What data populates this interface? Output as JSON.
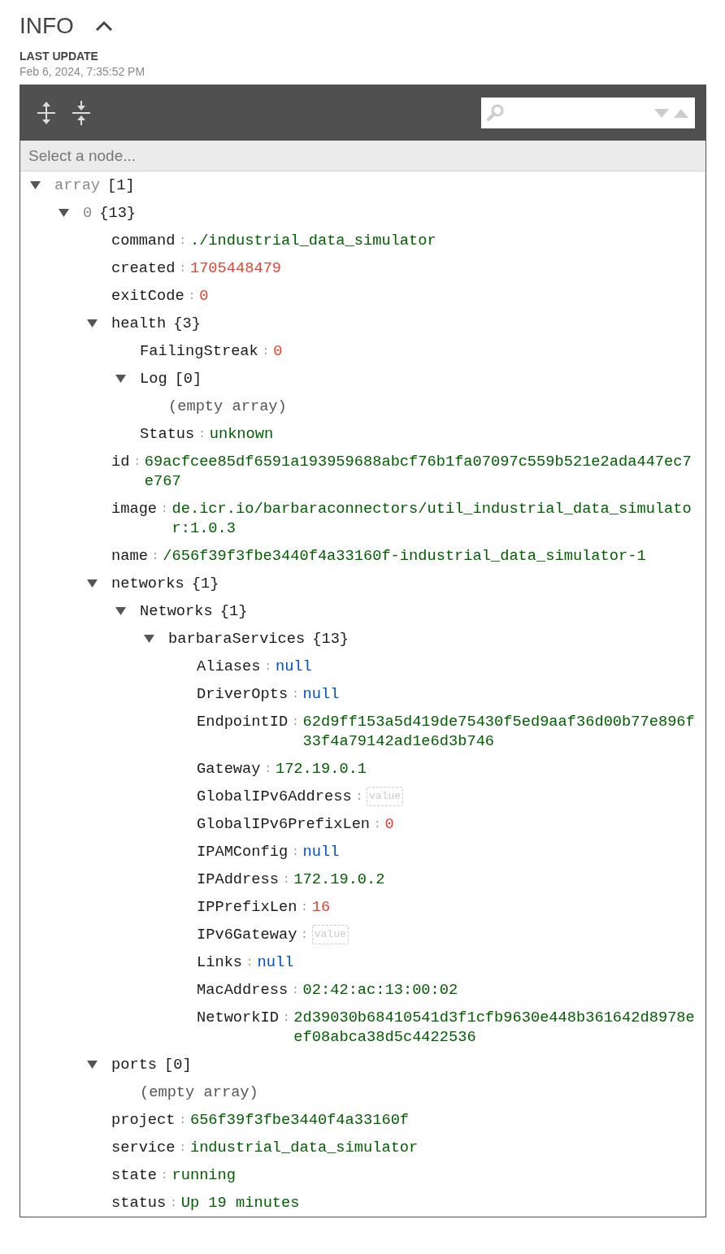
{
  "header": {
    "title": "INFO",
    "expanded": true,
    "update_label": "LAST UPDATE",
    "update_time": "Feb 6, 2024, 7:35:52 PM"
  },
  "editor": {
    "navigation_placeholder": "Select a node...",
    "tree": {
      "key": "array",
      "muted": true,
      "kind": "array",
      "count": "[1]",
      "expanded": true,
      "children": [
        {
          "key": "0",
          "muted": true,
          "kind": "object",
          "count": "{13}",
          "expanded": true,
          "children": [
            {
              "key": "command",
              "colon": ":",
              "kind": "string",
              "value": "./industrial_data_simulator"
            },
            {
              "key": "created",
              "colon": ":",
              "kind": "number",
              "value": "1705448479"
            },
            {
              "key": "exitCode",
              "colon": ":",
              "kind": "number",
              "value": "0"
            },
            {
              "key": "health",
              "kind": "object",
              "count": "{3}",
              "expanded": true,
              "children": [
                {
                  "key": "FailingStreak",
                  "colon": ":",
                  "kind": "number",
                  "value": "0"
                },
                {
                  "key": "Log",
                  "kind": "array",
                  "count": "[0]",
                  "expanded": true,
                  "empty_text": "(empty array)"
                },
                {
                  "key": "Status",
                  "colon": ":",
                  "kind": "string",
                  "value": "unknown"
                }
              ]
            },
            {
              "key": "id",
              "colon": ":",
              "kind": "string",
              "value": "69acfcee85df6591a193959688abcf76b1fa07097c559b521e2ada447ec7e767"
            },
            {
              "key": "image",
              "colon": ":",
              "kind": "string",
              "value": "de.icr.io/barbaraconnectors/util_industrial_data_simulator:1.0.3"
            },
            {
              "key": "name",
              "colon": ":",
              "kind": "string",
              "value": "/656f39f3fbe3440f4a33160f-industrial_data_simulator-1"
            },
            {
              "key": "networks",
              "kind": "object",
              "count": "{1}",
              "expanded": true,
              "children": [
                {
                  "key": "Networks",
                  "kind": "object",
                  "count": "{1}",
                  "expanded": true,
                  "children": [
                    {
                      "key": "barbaraServices",
                      "kind": "object",
                      "count": "{13}",
                      "expanded": true,
                      "children": [
                        {
                          "key": "Aliases",
                          "colon": ":",
                          "kind": "null",
                          "value": "null"
                        },
                        {
                          "key": "DriverOpts",
                          "colon": ":",
                          "kind": "null",
                          "value": "null"
                        },
                        {
                          "key": "EndpointID",
                          "colon": ":",
                          "kind": "string",
                          "value": "62d9ff153a5d419de75430f5ed9aaf36d00b77e896f33f4a79142ad1e6d3b746"
                        },
                        {
                          "key": "Gateway",
                          "colon": ":",
                          "kind": "string",
                          "value": "172.19.0.1"
                        },
                        {
                          "key": "GlobalIPv6Address",
                          "colon": ":",
                          "kind": "empty",
                          "placeholder": "value"
                        },
                        {
                          "key": "GlobalIPv6PrefixLen",
                          "colon": ":",
                          "kind": "number",
                          "value": "0"
                        },
                        {
                          "key": "IPAMConfig",
                          "colon": ":",
                          "kind": "null",
                          "value": "null"
                        },
                        {
                          "key": "IPAddress",
                          "colon": ":",
                          "kind": "string",
                          "value": "172.19.0.2"
                        },
                        {
                          "key": "IPPrefixLen",
                          "colon": ":",
                          "kind": "number",
                          "value": "16"
                        },
                        {
                          "key": "IPv6Gateway",
                          "colon": ":",
                          "kind": "empty",
                          "placeholder": "value"
                        },
                        {
                          "key": "Links",
                          "colon": ":",
                          "kind": "null",
                          "value": "null"
                        },
                        {
                          "key": "MacAddress",
                          "colon": ":",
                          "kind": "string",
                          "value": "02:42:ac:13:00:02"
                        },
                        {
                          "key": "NetworkID",
                          "colon": ":",
                          "kind": "string",
                          "value": "2d39030b68410541d3f1cfb9630e448b361642d8978eef08abca38d5c4422536"
                        }
                      ]
                    }
                  ]
                }
              ]
            },
            {
              "key": "ports",
              "kind": "array",
              "count": "[0]",
              "expanded": true,
              "empty_text": "(empty array)"
            },
            {
              "key": "project",
              "colon": ":",
              "kind": "string",
              "value": "656f39f3fbe3440f4a33160f"
            },
            {
              "key": "service",
              "colon": ":",
              "kind": "string",
              "value": "industrial_data_simulator"
            },
            {
              "key": "state",
              "colon": ":",
              "kind": "string",
              "value": "running"
            },
            {
              "key": "status",
              "colon": ":",
              "kind": "string",
              "value": "Up 19 minutes"
            }
          ]
        }
      ]
    }
  }
}
